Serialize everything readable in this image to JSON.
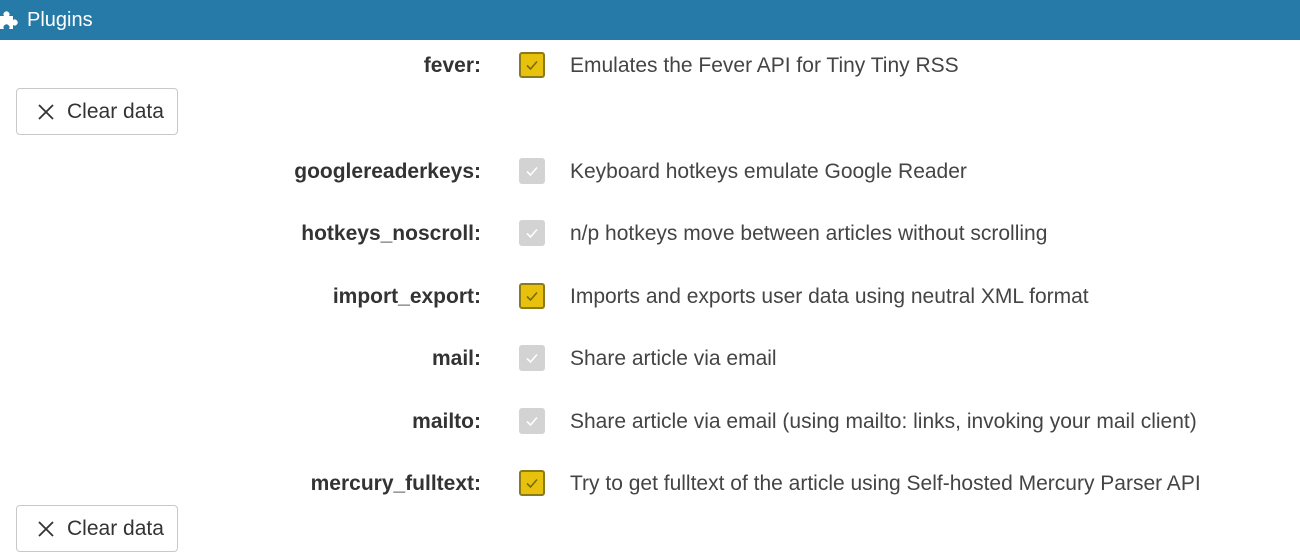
{
  "header": {
    "icon": "puzzle-icon",
    "title": "Plugins",
    "background": "#257aa7"
  },
  "clear_button": {
    "label": "Clear data",
    "icon": "close-icon"
  },
  "plugins": [
    {
      "name": "fever:",
      "enabled": true,
      "description": "Emulates the Fever API for Tiny Tiny RSS"
    },
    {
      "name": "googlereaderkeys:",
      "enabled": true,
      "locked": true,
      "description": "Keyboard hotkeys emulate Google Reader"
    },
    {
      "name": "hotkeys_noscroll:",
      "enabled": true,
      "locked": true,
      "description": "n/p hotkeys move between articles without scrolling"
    },
    {
      "name": "import_export:",
      "enabled": true,
      "description": "Imports and exports user data using neutral XML format"
    },
    {
      "name": "mail:",
      "enabled": true,
      "locked": true,
      "description": "Share article via email"
    },
    {
      "name": "mailto:",
      "enabled": true,
      "locked": true,
      "description": "Share article via email (using mailto: links, invoking your mail client)"
    },
    {
      "name": "mercury_fulltext:",
      "enabled": true,
      "description": "Try to get fulltext of the article using Self-hosted Mercury Parser API"
    }
  ],
  "colors": {
    "checkbox_on": "#e8c10d",
    "checkbox_locked": "#d3d3d3"
  }
}
